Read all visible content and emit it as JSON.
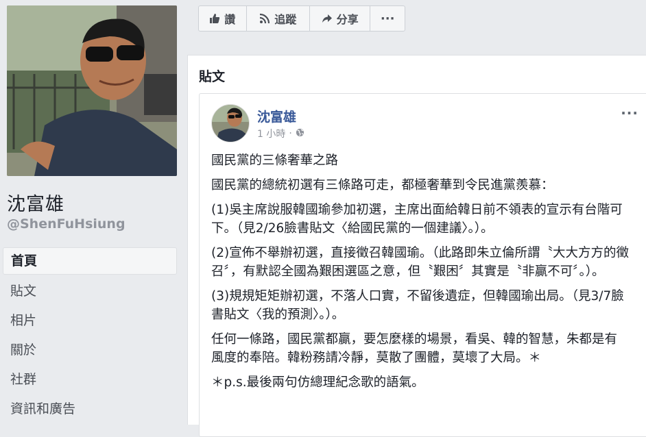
{
  "profile": {
    "name": "沈富雄",
    "handle": "@ShenFuHsiung"
  },
  "nav": {
    "items": [
      {
        "label": "首頁"
      },
      {
        "label": "貼文"
      },
      {
        "label": "相片"
      },
      {
        "label": "關於"
      },
      {
        "label": "社群"
      },
      {
        "label": "資訊和廣告"
      }
    ]
  },
  "actions": {
    "like": {
      "label": "讚",
      "icon": "thumbs-up-icon"
    },
    "follow": {
      "label": "追蹤",
      "icon": "rss-icon"
    },
    "share": {
      "label": "分享",
      "icon": "share-arrow-icon"
    },
    "more": {
      "label": "···"
    }
  },
  "posts_section": {
    "heading": "貼文"
  },
  "post": {
    "author": "沈富雄",
    "time": "1 小時",
    "dot": "·",
    "privacy_icon": "globe-icon",
    "more_label": "···",
    "paragraphs": [
      "國民黨的三條奢華之路",
      "國民黨的總統初選有三條路可走，都極奢華到令民進黨羨慕：",
      "(1)吳主席說服韓國瑜參加初選，主席出面給韓日前不領表的宣示有台階可下。（見2/26臉書貼文〈給國民黨的一個建議〉。）。",
      "(2)宣佈不舉辦初選，直接徵召韓國瑜。（此路即朱立倫所謂〝大大方方的徵召〞，有默認全國為艱困選區之意，但〝艱困〞其實是〝非贏不可〞。）。",
      "(3)規規矩矩辦初選，不落人口實，不留後遺症，但韓國瑜出局。（見3/7臉書貼文〈我的預測〉。）。",
      "任何一條路，國民黨都贏，要怎麼樣的場景，看吳、韓的智慧，朱都是有風度的奉陪。韓粉務請冷靜，莫散了團體，莫壞了大局。＊",
      "＊p.s.最後兩句仿總理紀念歌的語氣。"
    ]
  },
  "colors": {
    "background": "#e9ebee",
    "link": "#385898",
    "muted": "#90949c"
  }
}
